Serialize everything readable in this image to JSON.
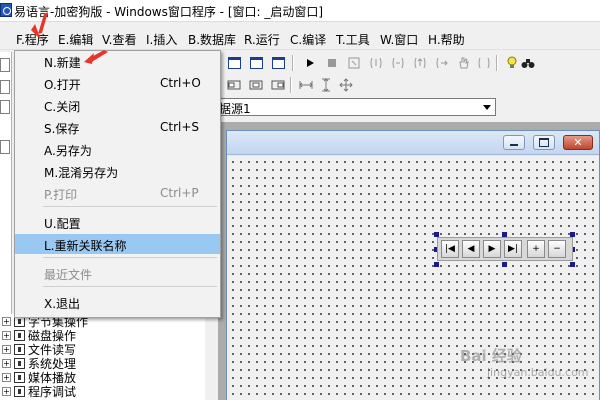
{
  "window": {
    "title": "易语言-加密狗版 - Windows窗口程序 - [窗口: _启动窗口]"
  },
  "menubar": {
    "items": [
      {
        "label": "F.程序"
      },
      {
        "label": "E.编辑"
      },
      {
        "label": "V.查看"
      },
      {
        "label": "I.插入"
      },
      {
        "label": "B.数据库"
      },
      {
        "label": "R.运行"
      },
      {
        "label": "C.编译"
      },
      {
        "label": "T.工具"
      },
      {
        "label": "W.窗口"
      },
      {
        "label": "H.帮助"
      }
    ]
  },
  "file_menu": {
    "items": [
      {
        "label": "N.新建",
        "shortcut": "",
        "enabled": true,
        "highlighted": false
      },
      {
        "label": "O.打开",
        "shortcut": "Ctrl+O",
        "enabled": true,
        "highlighted": false
      },
      {
        "label": "C.关闭",
        "shortcut": "",
        "enabled": true,
        "highlighted": false
      },
      {
        "label": "S.保存",
        "shortcut": "Ctrl+S",
        "enabled": true,
        "highlighted": false
      },
      {
        "label": "A.另存为",
        "shortcut": "",
        "enabled": true,
        "highlighted": false
      },
      {
        "label": "M.混淆另存为",
        "shortcut": "",
        "enabled": true,
        "highlighted": false
      },
      {
        "label": "P.打印",
        "shortcut": "Ctrl+P",
        "enabled": false,
        "highlighted": false
      },
      {
        "label": "U.配置",
        "shortcut": "",
        "enabled": true,
        "highlighted": false
      },
      {
        "label": "L.重新关联名称",
        "shortcut": "",
        "enabled": true,
        "highlighted": true
      },
      {
        "label": "最近文件",
        "shortcut": "",
        "enabled": false,
        "highlighted": false
      },
      {
        "label": "X.退出",
        "shortcut": "",
        "enabled": true,
        "highlighted": false
      }
    ]
  },
  "datasource_combo": {
    "value": "据源1"
  },
  "support_tree": {
    "items": [
      {
        "label": "字节集操作"
      },
      {
        "label": "磁盘操作"
      },
      {
        "label": "文件读写"
      },
      {
        "label": "系统处理"
      },
      {
        "label": "媒体播放"
      },
      {
        "label": "程序调试"
      }
    ]
  },
  "media_control": {
    "buttons": [
      "|◀",
      "◀",
      "▶",
      "▶|",
      "+",
      "−"
    ]
  },
  "watermark": {
    "text": "Bai 经验",
    "url": "jingyan.baidu.com"
  },
  "colors": {
    "menu_highlight": "#99c9f2",
    "annotation_arrow": "#e8352a",
    "selection_handle": "#1a1a8c"
  }
}
